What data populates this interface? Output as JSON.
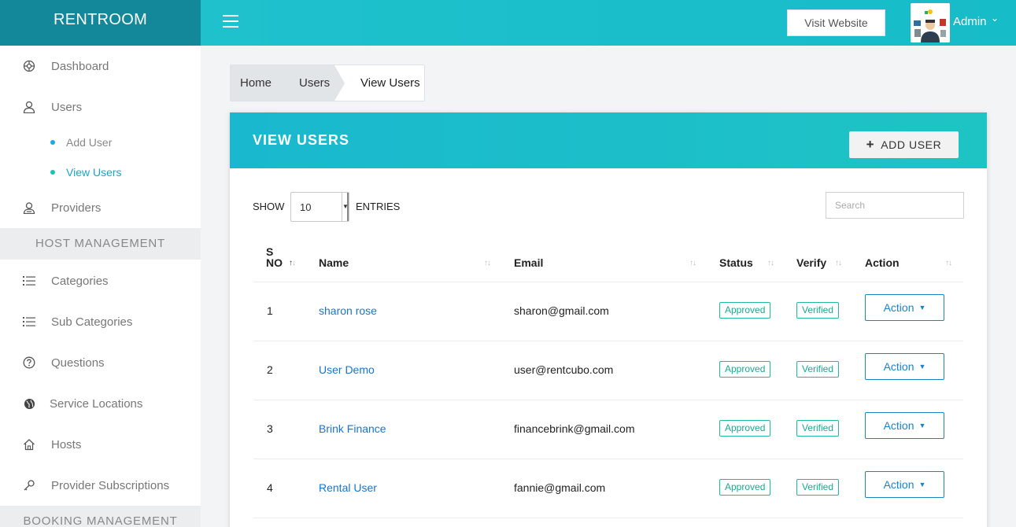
{
  "brand": "RENTROOM",
  "header": {
    "visit_website": "Visit Website",
    "admin_name": "Admin"
  },
  "sidebar": {
    "items": [
      {
        "label": "Dashboard",
        "icon": "dashboard-icon"
      },
      {
        "label": "Users",
        "icon": "user-icon"
      },
      {
        "label": "Providers",
        "icon": "provider-icon"
      },
      {
        "label": "Categories",
        "icon": "list-icon"
      },
      {
        "label": "Sub Categories",
        "icon": "list-icon"
      },
      {
        "label": "Questions",
        "icon": "question-icon"
      },
      {
        "label": "Service Locations",
        "icon": "globe-icon"
      },
      {
        "label": "Hosts",
        "icon": "home-icon"
      },
      {
        "label": "Provider Subscriptions",
        "icon": "key-icon"
      }
    ],
    "sub_items": [
      {
        "label": "Add User"
      },
      {
        "label": "View Users",
        "active": true
      }
    ],
    "sections": [
      "HOST MANAGEMENT",
      "BOOKING MANAGEMENT"
    ]
  },
  "breadcrumb": [
    "Home",
    "Users",
    "View Users"
  ],
  "card": {
    "title": "VIEW USERS",
    "add_button": "ADD USER"
  },
  "table_controls": {
    "show_label": "SHOW",
    "entries_value": "10",
    "entries_label": "ENTRIES",
    "search_placeholder": "Search"
  },
  "table": {
    "columns": [
      "S NO",
      "Name",
      "Email",
      "Status",
      "Verify",
      "Action"
    ],
    "rows": [
      {
        "sno": "1",
        "name": "sharon rose",
        "email": "sharon@gmail.com",
        "status": "Approved",
        "verify": "Verified",
        "action": "Action"
      },
      {
        "sno": "2",
        "name": "User Demo",
        "email": "user@rentcubo.com",
        "status": "Approved",
        "verify": "Verified",
        "action": "Action"
      },
      {
        "sno": "3",
        "name": "Brink Finance",
        "email": "financebrink@gmail.com",
        "status": "Approved",
        "verify": "Verified",
        "action": "Action"
      },
      {
        "sno": "4",
        "name": "Rental User",
        "email": "fannie@gmail.com",
        "status": "Approved",
        "verify": "Verified",
        "action": "Action"
      }
    ]
  },
  "colors": {
    "brand_bg": "#12889a",
    "topbar": "#1ec1cc",
    "link": "#1a74c9",
    "badge": "#1ba88f"
  }
}
